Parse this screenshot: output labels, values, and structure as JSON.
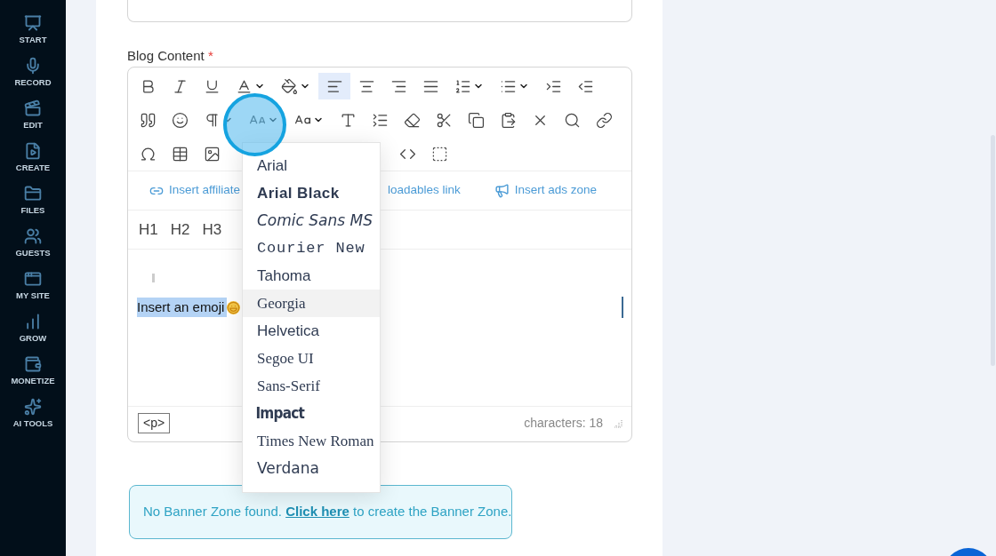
{
  "sidebar": {
    "items": [
      {
        "label": "START"
      },
      {
        "label": "RECORD"
      },
      {
        "label": "EDIT"
      },
      {
        "label": "CREATE"
      },
      {
        "label": "FILES"
      },
      {
        "label": "GUESTS"
      },
      {
        "label": "MY SITE"
      },
      {
        "label": "GROW"
      },
      {
        "label": "MONETIZE"
      },
      {
        "label": "AI TOOLS"
      }
    ]
  },
  "field": {
    "label": "Blog Content",
    "required_mark": "*"
  },
  "toolbar": {
    "rows": [
      [
        {
          "selected": false
        },
        {
          "selected": false
        },
        {
          "selected": false
        },
        {
          "selected": false
        },
        {
          "selected": false
        },
        {
          "selected": true
        },
        {
          "selected": false
        },
        {
          "selected": false
        },
        {
          "selected": false
        },
        {
          "selected": false
        },
        {
          "selected": false
        },
        {
          "selected": false
        },
        {
          "selected": false
        }
      ],
      [
        {
          "selected": false
        },
        {
          "selected": false
        },
        {
          "selected": false
        },
        {
          "selected": false
        },
        {
          "selected": false
        },
        {
          "selected": false
        },
        {
          "selected": false
        },
        {
          "selected": false
        },
        {
          "selected": false
        },
        {
          "selected": false
        },
        {
          "selected": false
        },
        {
          "selected": false
        },
        {
          "selected": false
        },
        {
          "selected": false
        }
      ]
    ]
  },
  "insert_links": [
    "Insert affiliate",
    "loadables link",
    "Insert ads zone"
  ],
  "headings": [
    "H1",
    "H2",
    "H3"
  ],
  "content": {
    "text": "Insert an emoji",
    "selected": true
  },
  "status": {
    "tag": "<p>",
    "count": "characters: 18"
  },
  "font_menu": [
    {
      "label": "Arial",
      "kind": "sans",
      "selected": false
    },
    {
      "label": "Arial Black",
      "kind": "black",
      "selected": false
    },
    {
      "label": "Comic Sans MS",
      "kind": "casual",
      "selected": false
    },
    {
      "label": "Courier New",
      "kind": "mono",
      "selected": false
    },
    {
      "label": "Tahoma",
      "kind": "sans",
      "selected": false
    },
    {
      "label": "Georgia",
      "kind": "serif",
      "selected": true
    },
    {
      "label": "Helvetica",
      "kind": "sans",
      "selected": false
    },
    {
      "label": "Segoe UI",
      "kind": "serif",
      "selected": false
    },
    {
      "label": "Sans-Serif",
      "kind": "serif",
      "selected": false
    },
    {
      "label": "Impact",
      "kind": "condensed",
      "selected": false
    },
    {
      "label": "Times New Roman",
      "kind": "serif",
      "selected": false
    },
    {
      "label": "Verdana",
      "kind": "wide",
      "selected": false
    }
  ],
  "banner": {
    "before": "No Banner Zone found.",
    "link": "Click here",
    "after": "to create the Banner Zone."
  }
}
